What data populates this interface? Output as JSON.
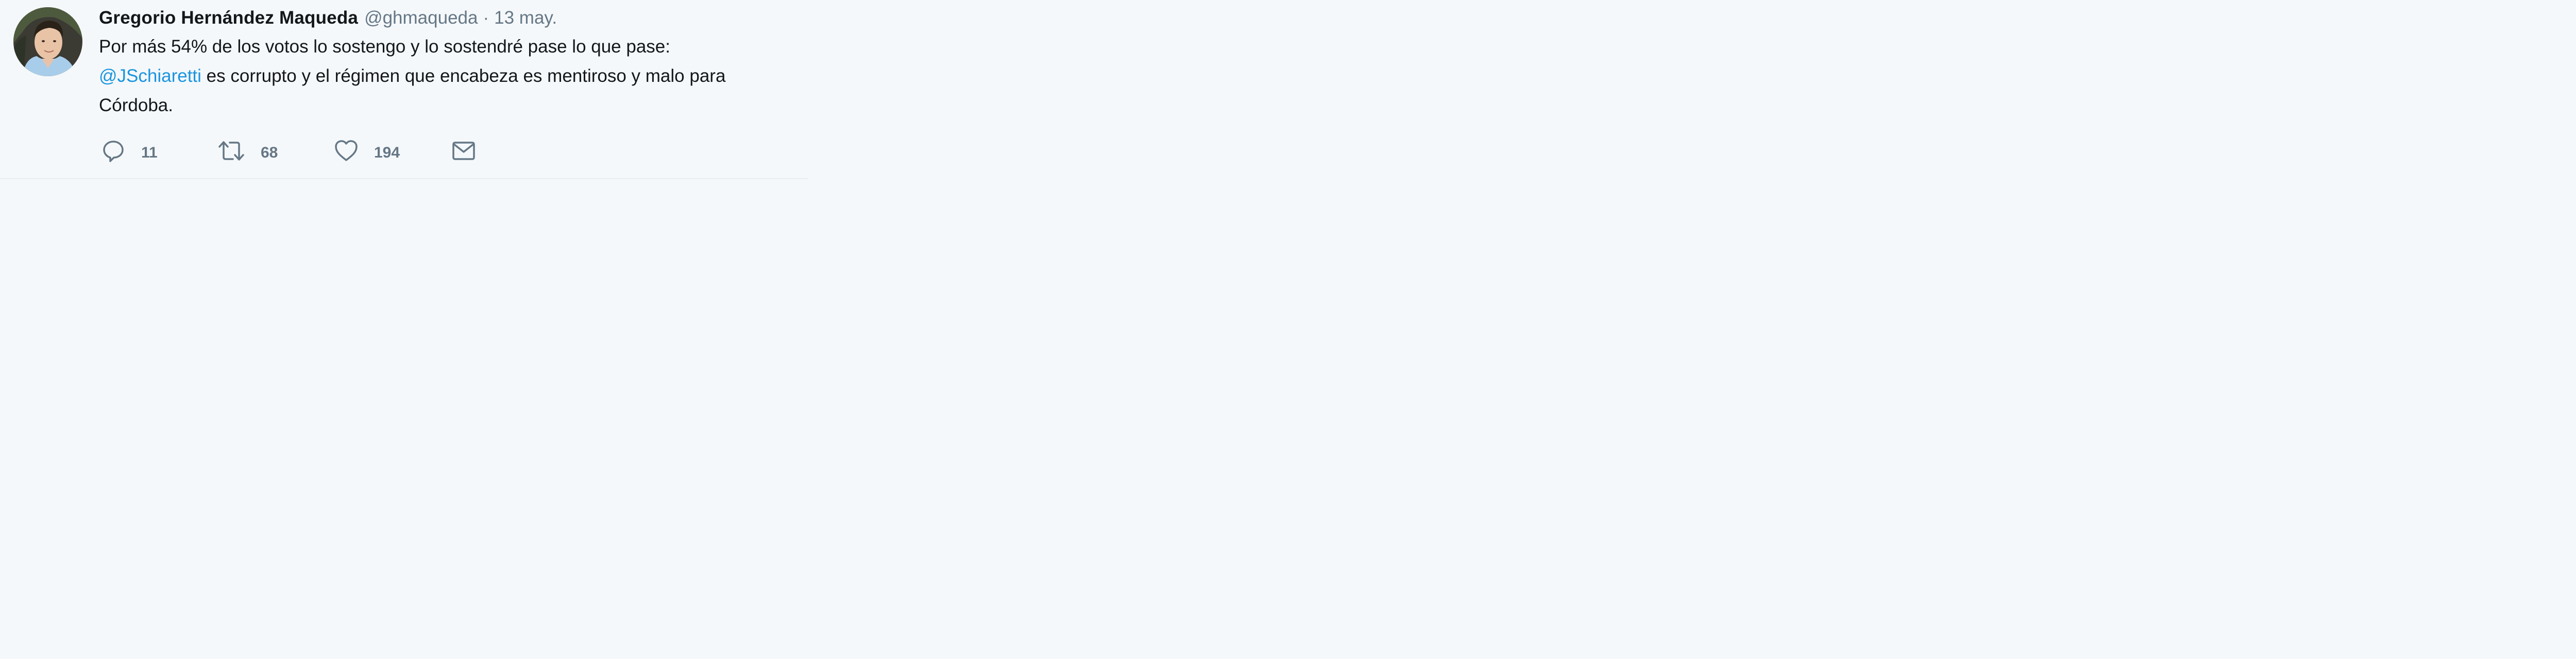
{
  "tweet": {
    "author": {
      "name": "Gregorio Hernández Maqueda",
      "handle": "@ghmaqueda",
      "separator": "·",
      "date": "13 may."
    },
    "text": {
      "line1": "Por más 54% de los votos lo sostengo y lo sostendré pase lo que pase:",
      "mention": "@JSchiaretti",
      "rest": " es corrupto y el régimen que encabeza es mentiroso y malo para Córdoba."
    },
    "actions": {
      "reply": {
        "icon": "reply-icon",
        "count": "11"
      },
      "retweet": {
        "icon": "retweet-icon",
        "count": "68"
      },
      "like": {
        "icon": "heart-icon",
        "count": "194"
      },
      "message": {
        "icon": "envelope-icon"
      }
    }
  },
  "colors": {
    "background": "#f5f8fa",
    "text": "#14171a",
    "secondary": "#657786",
    "link": "#1b95e0"
  }
}
